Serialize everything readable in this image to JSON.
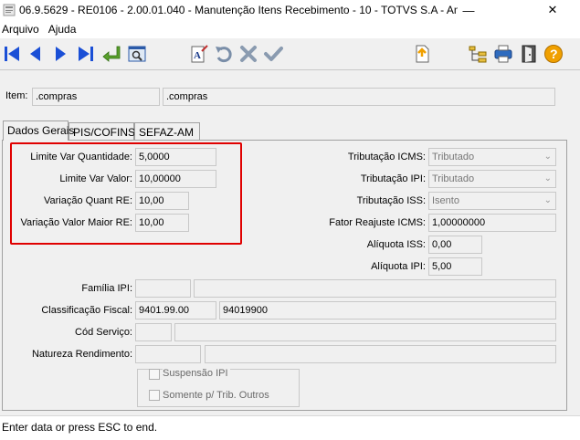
{
  "window": {
    "title": "06.9.5629 - RE0106 - 2.00.01.040 - Manutenção Itens Recebimento - 10 - TOTVS S.A - Am...",
    "minimize": "—",
    "close": "✕"
  },
  "menu": [
    "Arquivo",
    "Ajuda"
  ],
  "item": {
    "label": "Item:",
    "code": ".compras",
    "description": ".compras"
  },
  "tabs": [
    "Dados Gerais",
    "PIS/COFINS",
    "SEFAZ-AM"
  ],
  "left_fields": [
    {
      "label": "Limite Var Quantidade:",
      "value": "5,0000"
    },
    {
      "label": "Limite Var Valor:",
      "value": "10,00000"
    },
    {
      "label": "Variação Quant RE:",
      "value": "10,00"
    },
    {
      "label": "Variação Valor Maior RE:",
      "value": "10,00"
    }
  ],
  "right_fields": {
    "tributacao_icms": {
      "label": "Tributação ICMS:",
      "value": "Tributado"
    },
    "tributacao_ipi": {
      "label": "Tributação IPI:",
      "value": "Tributado"
    },
    "tributacao_iss": {
      "label": "Tributação ISS:",
      "value": "Isento"
    },
    "fator_reajuste": {
      "label": "Fator Reajuste ICMS:",
      "value": "1,00000000"
    },
    "aliquota_iss": {
      "label": "Alíquota ISS:",
      "value": "0,00"
    },
    "aliquota_ipi": {
      "label": "Alíquota IPI:",
      "value": "5,00"
    }
  },
  "lower_fields": {
    "familia_ipi": {
      "label": "Família IPI:",
      "code": "",
      "description": ""
    },
    "classificacao_fiscal": {
      "label": "Classificação Fiscal:",
      "code": "9401.99.00",
      "description": "94019900"
    },
    "cod_servico": {
      "label": "Cód Serviço:",
      "code": "",
      "description": ""
    },
    "natureza_rendimento": {
      "label": "Natureza Rendimento:",
      "code": "",
      "description": ""
    }
  },
  "checkboxes": {
    "suspensao_ipi": "Suspensão IPI",
    "somente_trib_outros": "Somente p/ Trib. Outros"
  },
  "status": "Enter data or press ESC to end.",
  "colors": {
    "highlight_box": "#e00000",
    "nav_blue": "#1a4fd6",
    "help_orange": "#f0a000"
  }
}
